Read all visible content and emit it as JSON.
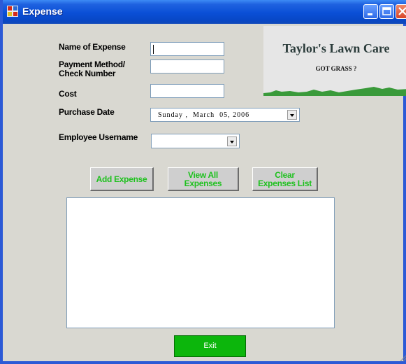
{
  "window": {
    "title": "Expense"
  },
  "form": {
    "name_label": "Name of Expense",
    "payment_label": "Payment Method/\nCheck Number",
    "cost_label": "Cost",
    "date_label": "Purchase Date",
    "employee_label": "Employee Username",
    "name_value": "",
    "payment_value": "",
    "cost_value": "",
    "date_value": "Sunday ,  March  05, 2006",
    "employee_value": ""
  },
  "logo": {
    "title": "Taylor's Lawn Care",
    "subtitle": "GOT GRASS ?"
  },
  "buttons": {
    "add": "Add Expense",
    "view": "View All\nExpenses",
    "clear": "Clear\nExpenses List",
    "exit": "Exit"
  },
  "expenses_list": [],
  "colors": {
    "title_bar": "#0a4fd6",
    "button_text": "#1fc11f",
    "exit_button": "#0cb60c",
    "window_bg": "#d9d8d1"
  }
}
